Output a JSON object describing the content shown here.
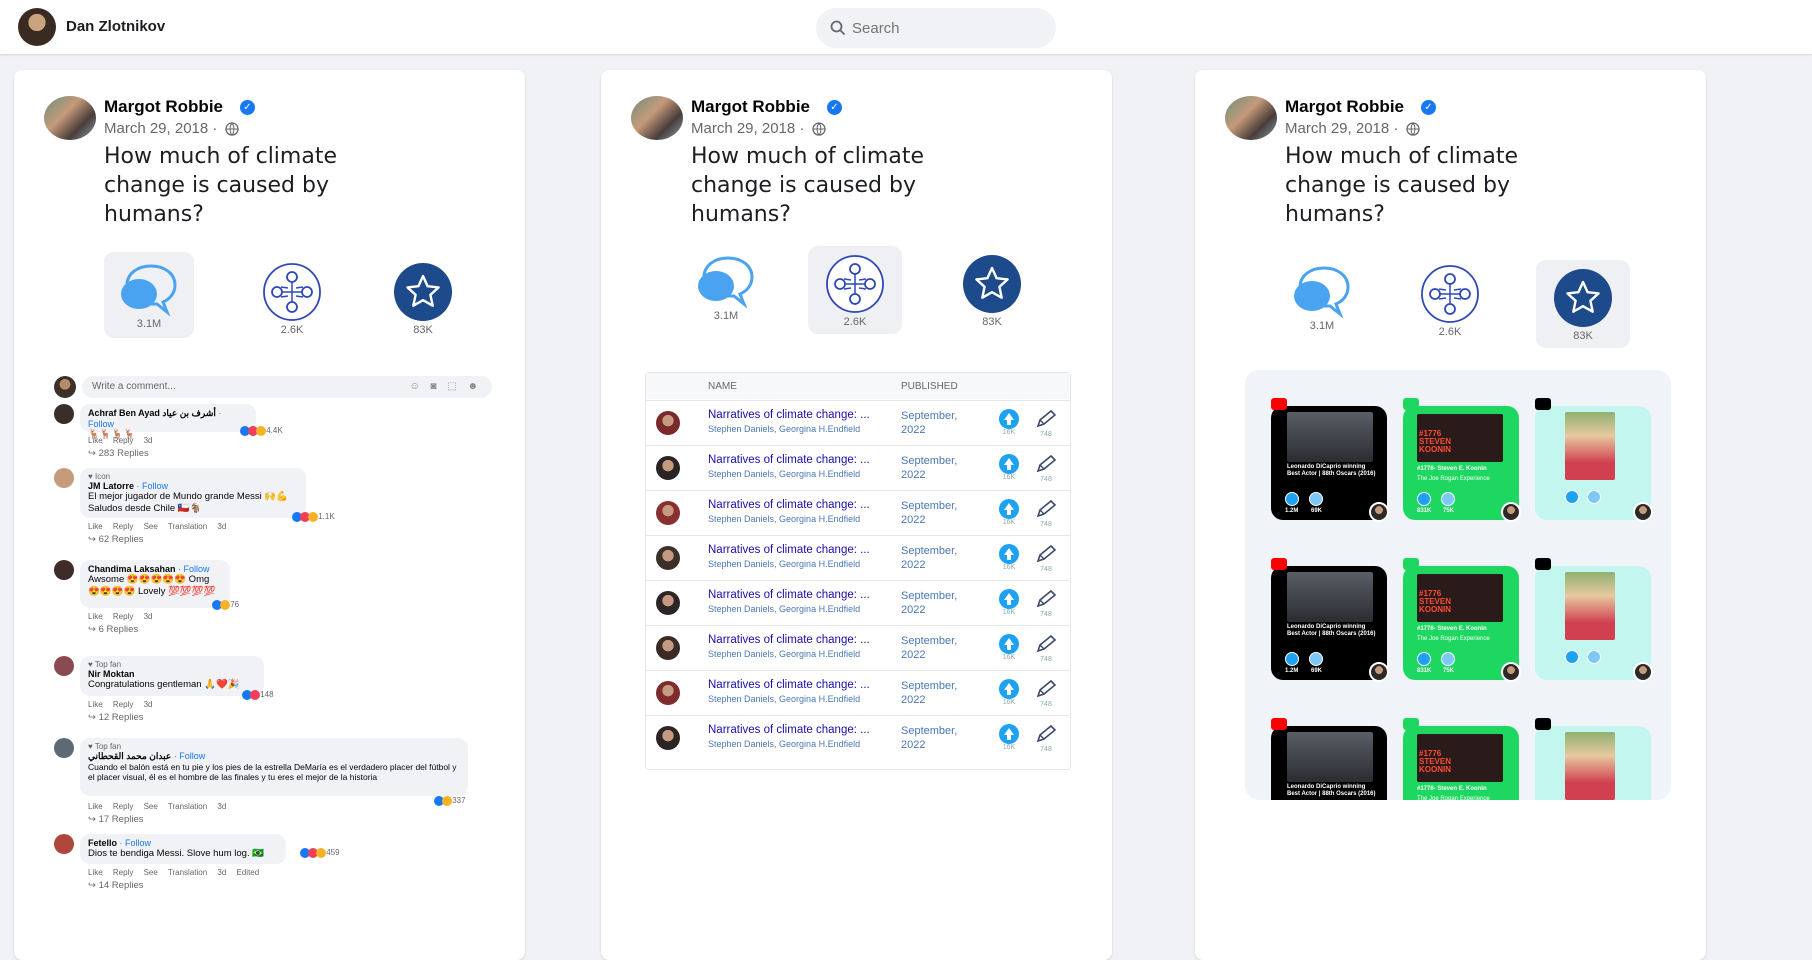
{
  "topbar": {
    "user_name": "Dan Zlotnikov",
    "search_placeholder": "Search"
  },
  "post": {
    "author": "Margot Robbie",
    "date": "March 29, 2018 ·",
    "question": "How much of climate change is caused by humans?"
  },
  "panels": [
    {
      "comments_count": "3.1M",
      "share_count": "2.6K",
      "star_count": "83K",
      "active": "comments"
    },
    {
      "comments_count": "3.1M",
      "share_count": "2.6K",
      "star_count": "83K",
      "active": "share"
    },
    {
      "comments_count": "3.1M",
      "share_count": "2.6K",
      "star_count": "83K",
      "active": "star"
    }
  ],
  "comments": {
    "placeholder": "Write a comment...",
    "items": [
      {
        "name": "Achraf Ben Ayad أشرف بن عياد",
        "tag": "",
        "follow": "· Follow",
        "text": "🦌🦌🦌🦌",
        "meta": "Like Reply 3d",
        "reactions": "4.4K",
        "replies": "↪ 283 Replies"
      },
      {
        "name": "JM Latorre",
        "tag": "♥ Icon",
        "follow": "· Follow",
        "text": "El mejor jugador de Mundo grande Messi 🙌💪 Saludos desde Chile 🇨🇱🐐",
        "meta": "Like Reply See Translation 3d",
        "reactions": "1.1K",
        "replies": "↪ 62 Replies"
      },
      {
        "name": "Chandima Laksahan",
        "tag": "",
        "follow": "· Follow",
        "text": "Awsome 😍😍😍😍😍 Omg 😍😍😍😍 Lovely 💯💯💯💯",
        "meta": "Like Reply 3d",
        "reactions": "76",
        "replies": "↪ 6 Replies"
      },
      {
        "name": "Nir Moktan",
        "tag": "♥ Top fan",
        "follow": "",
        "text": "Congratulations gentleman 🙏❤️🎉",
        "meta": "Like Reply 3d",
        "reactions": "148",
        "replies": "↪ 12 Replies"
      },
      {
        "name": "عبدان محمد القحطاني",
        "tag": "♥ Top fan",
        "follow": "· Follow",
        "text": "Cuando el balón está en tu pie y los pies de la estrella DeMaría es el verdadero placer del fútbol y el placer visual, él es el hombre de las finales y tu eres el mejor de la historia",
        "meta": "Like Reply See Translation 3d",
        "reactions": "337",
        "replies": "↪ 17 Replies"
      },
      {
        "name": "Fetello",
        "tag": "",
        "follow": "· Follow",
        "text": "Dios te bendiga Messi. Slove hum log. 🇧🇷",
        "meta": "Like Reply See Translation 3d Edited",
        "reactions": "459",
        "replies": "↪ 14 Replies"
      }
    ]
  },
  "papers": {
    "col_name": "NAME",
    "col_published": "PUBLISHED",
    "rows": [
      {
        "title": "Narratives of climate change: ...",
        "authors": "Stephen Daniels, Georgina H.Endfield",
        "date": "September, 2022",
        "up": "16K",
        "edit": "748"
      },
      {
        "title": "Narratives of climate change: ...",
        "authors": "Stephen Daniels, Georgina H.Endfield",
        "date": "September, 2022",
        "up": "16K",
        "edit": "748"
      },
      {
        "title": "Narratives of climate change: ...",
        "authors": "Stephen Daniels, Georgina H.Endfield",
        "date": "September, 2022",
        "up": "16K",
        "edit": "748"
      },
      {
        "title": "Narratives of climate change: ...",
        "authors": "Stephen Daniels, Georgina H.Endfield",
        "date": "September, 2022",
        "up": "16K",
        "edit": "748"
      },
      {
        "title": "Narratives of climate change: ...",
        "authors": "Stephen Daniels, Georgina H.Endfield",
        "date": "September, 2022",
        "up": "16K",
        "edit": "748"
      },
      {
        "title": "Narratives of climate change: ...",
        "authors": "Stephen Daniels, Georgina H.Endfield",
        "date": "September, 2022",
        "up": "16K",
        "edit": "748"
      },
      {
        "title": "Narratives of climate change: ...",
        "authors": "Stephen Daniels, Georgina H.Endfield",
        "date": "September, 2022",
        "up": "16K",
        "edit": "748"
      },
      {
        "title": "Narratives of climate change: ...",
        "authors": "Stephen Daniels, Georgina H.Endfield",
        "date": "September, 2022",
        "up": "16K",
        "edit": "748"
      }
    ]
  },
  "media": {
    "youtube": {
      "title": "Leonardo DiCaprio winning Best Actor | 88th Oscars (2016)",
      "likes": "1.2M",
      "comments": "69K"
    },
    "spotify": {
      "title": "#1776- Steven E. Koonin",
      "subtitle": "The Joe Rogan Experience",
      "likes": "831K",
      "comments": "75K",
      "banner": "#1776 STEVEN KOONIN"
    },
    "tiktok": {
      "title": ""
    }
  },
  "colors": {
    "accent": "#1877f2",
    "youtube_tile": "#000000",
    "spotify_tile": "#1ed760",
    "tiktok_tile": "#c2f6ef"
  }
}
